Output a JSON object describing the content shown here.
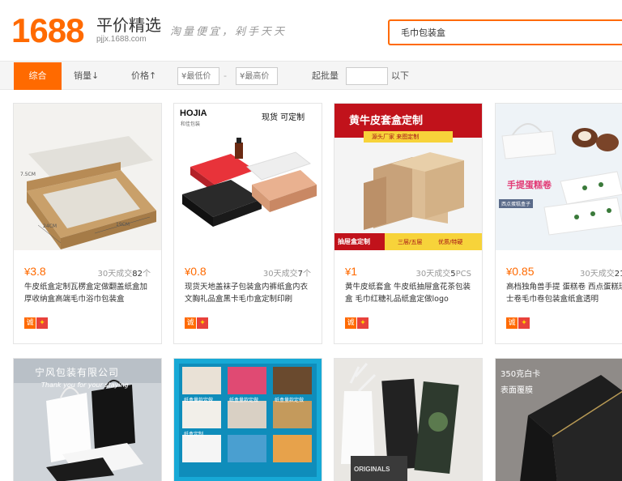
{
  "header": {
    "logo_number": "1688",
    "logo_title": "平价精选",
    "logo_subtitle": "pjjx.1688.com",
    "slogan": "淘量便宜，剁手天天",
    "search_value": "毛巾包装盒"
  },
  "filters": {
    "sort_default": "综合",
    "sort_sales": "销量↓",
    "sort_price": "价格↑",
    "min_price_placeholder": "¥最低价",
    "price_separator": "-",
    "max_price_placeholder": "¥最高价",
    "batch_label": "起批量",
    "batch_suffix": "以下"
  },
  "products": [
    {
      "price": "3.8",
      "sales_prefix": "30天成交",
      "sales_count": "82",
      "sales_unit": "个",
      "title": "牛皮纸盒定制瓦楞盒定做翻盖纸盒加厚收纳盒高端毛巾浴巾包装盒",
      "image_text": [
        "24CM",
        "19CM",
        "7.5CM"
      ]
    },
    {
      "price": "0.8",
      "sales_prefix": "30天成交",
      "sales_count": "7",
      "sales_unit": "个",
      "title": "现货天地盖袜子包装盒内裤纸盒内衣文胸礼品盒黑卡毛巾盒定制印刷",
      "image_text": [
        "HOJIA",
        "和佳包装",
        "现货  可定制"
      ]
    },
    {
      "price": "1",
      "sales_prefix": "30天成交",
      "sales_count": "5",
      "sales_unit": "PCS",
      "title": "黄牛皮纸套盒 牛皮纸抽屉盒花茶包装盒 毛巾红糖礼品纸盒定做logo",
      "image_text": [
        "黄牛皮套盒定制",
        "源头厂家  来图定制",
        "抽屉盒定制",
        "三层/五层",
        "优质/特硬"
      ]
    },
    {
      "price": "0.85",
      "sales_prefix": "30天成交",
      "sales_count": "21",
      "sales_unit": "",
      "title": "高档独角兽手提 蛋糕卷 西点蛋糕瑞士卷毛巾卷包装盒纸盒透明",
      "image_text": [
        "手提蛋糕卷",
        "西点蛋糕盒子"
      ]
    }
  ],
  "row2_image_text": {
    "card5": [
      "宁风包装有限公司",
      "Thank you for your staying"
    ],
    "card6": [
      "纸盒定制",
      "纸盒量款定做",
      "纸盒量款定做",
      "纸盒量款定做"
    ],
    "card7": [
      "ORIGINALS"
    ],
    "card8": [
      "350克白卡",
      "表面覆膜"
    ]
  },
  "badges": {
    "a": "诚",
    "b": "✦"
  },
  "colors": {
    "accent": "#ff6a00",
    "badge_red": "#e8413b"
  }
}
